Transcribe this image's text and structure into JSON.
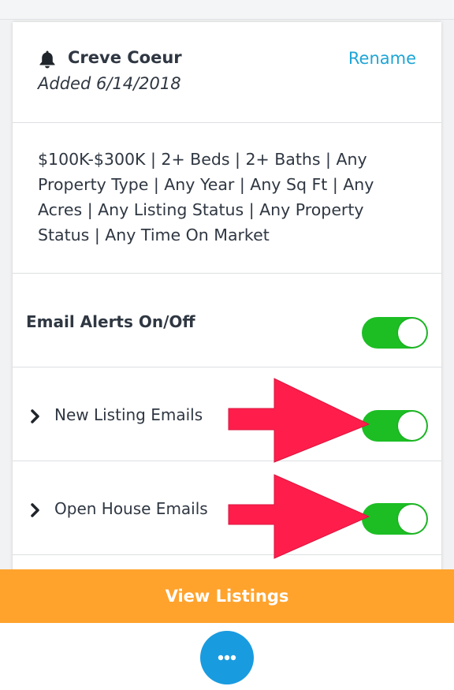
{
  "search": {
    "title": "Creve Coeur",
    "added": "Added 6/14/2018",
    "rename_label": "Rename",
    "criteria": "$100K-$300K | 2+ Beds | 2+ Baths | Any Property Type | Any Year | Any Sq Ft | Any Acres | Any Listing Status | Any Property Status | Any Time On Market"
  },
  "settings": [
    {
      "label": "Email Alerts On/Off",
      "enabled": true
    },
    {
      "label": "New Listing Emails",
      "enabled": true
    },
    {
      "label": "Open House Emails",
      "enabled": true
    }
  ],
  "view_listings_label": "View Listings",
  "icons": {
    "bell": "bell-icon",
    "chevron": "chevron-right-icon",
    "more": "more-dots-icon",
    "annotation_arrow": "arrow-right-icon"
  },
  "colors": {
    "accent_link": "#1ea5d6",
    "toggle_on": "#1cbe24",
    "primary_button": "#ffa32d",
    "fab": "#199be0",
    "annotation_arrow": "#ff1e4b"
  }
}
